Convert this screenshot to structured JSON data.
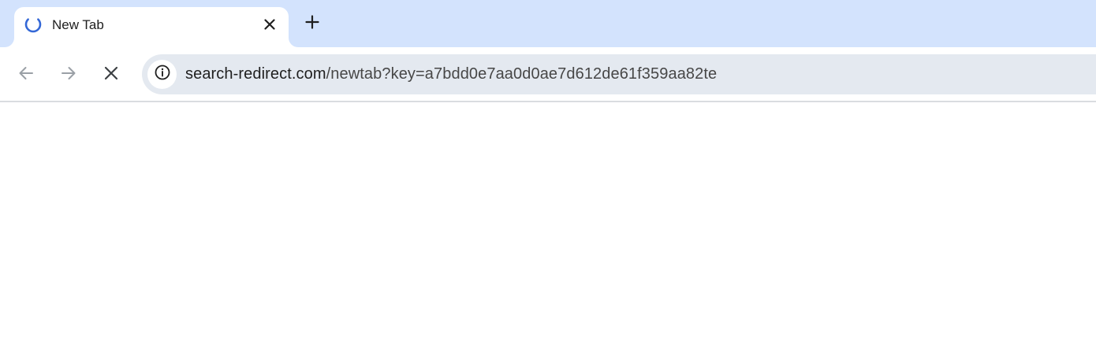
{
  "tab": {
    "title": "New Tab",
    "icon": "loading-spinner-icon"
  },
  "tabstrip": {
    "new_tab_icon": "plus-icon"
  },
  "toolbar": {
    "back_icon": "arrow-left-icon",
    "forward_icon": "arrow-right-icon",
    "stop_icon": "close-icon",
    "site_info_icon": "info-icon"
  },
  "omnibox": {
    "host": "search-redirect.com",
    "path": "/newtab?key=a7bdd0e7aa0d0ae7d612de61f359aa82te"
  },
  "colors": {
    "tabstrip_bg": "#d3e3fd",
    "omnibox_bg": "#e4e9f0",
    "spinner": "#3367d6"
  }
}
